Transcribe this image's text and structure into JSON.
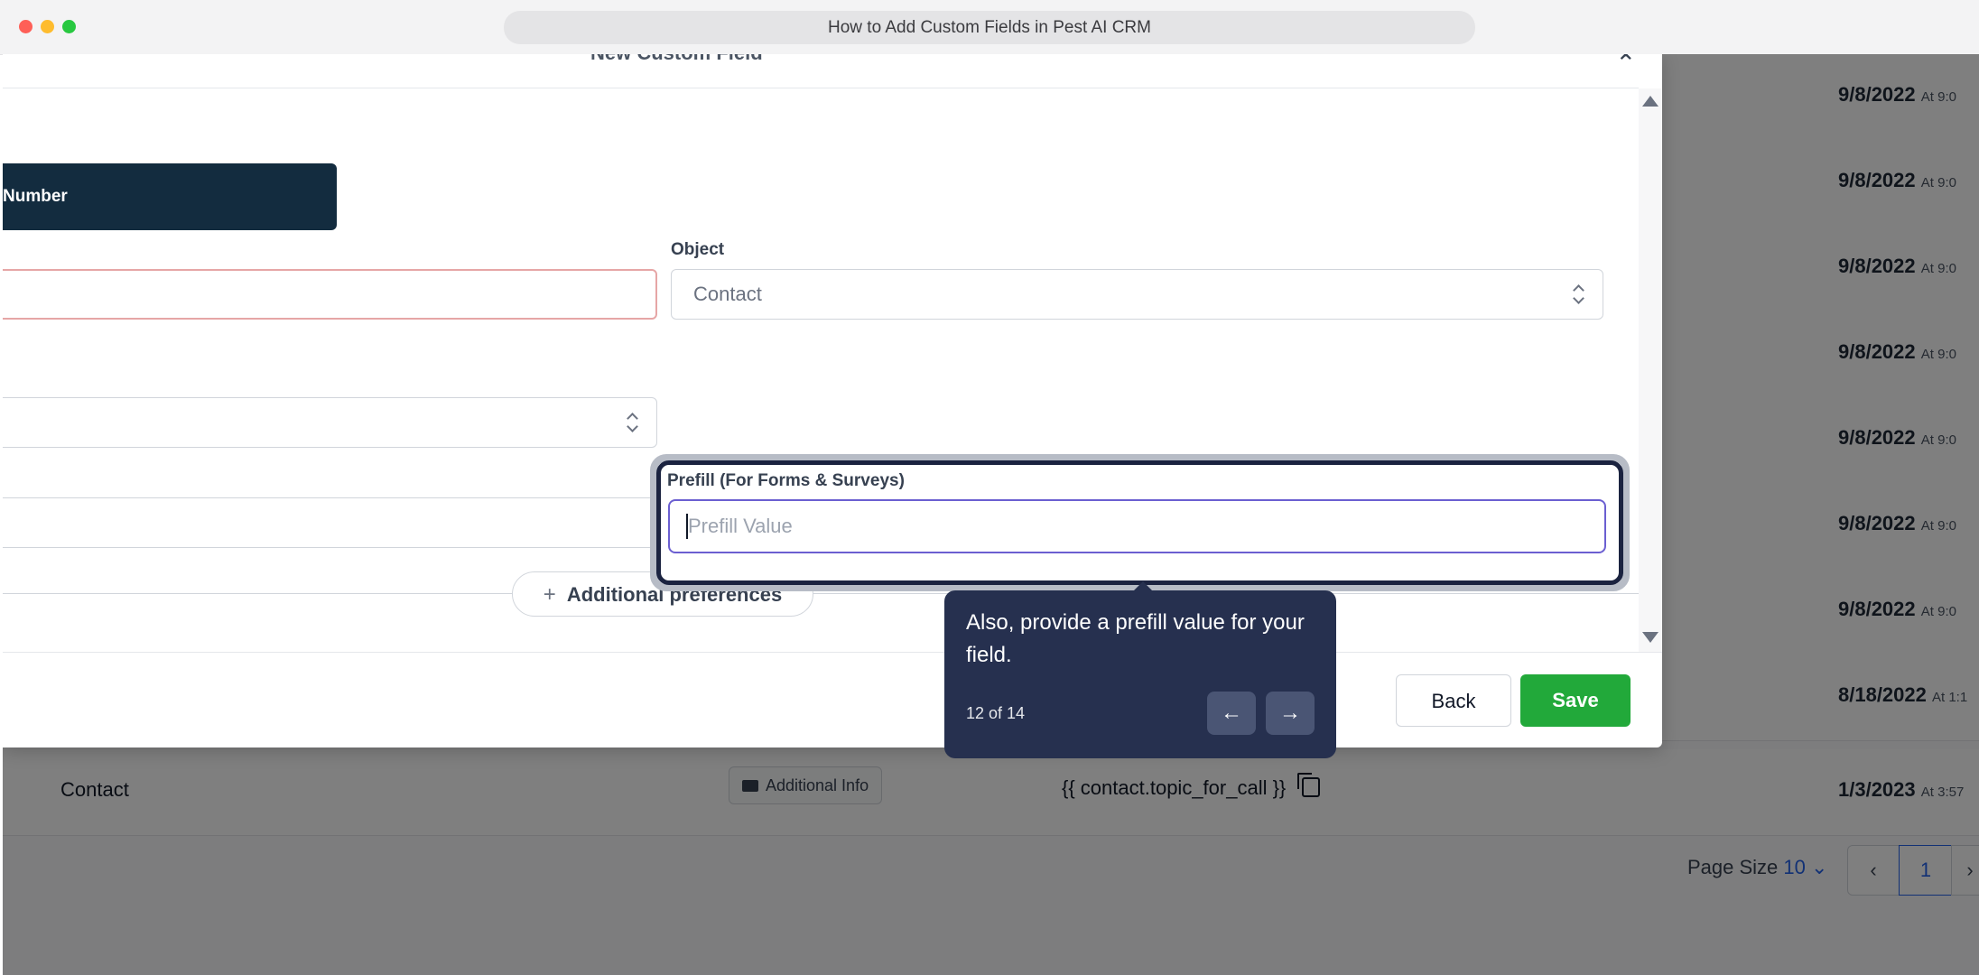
{
  "window": {
    "title": "How to Add Custom Fields in Pest AI CRM"
  },
  "background_table": {
    "rows": [
      {
        "date": "9/8/2022",
        "at": "At 9:0"
      },
      {
        "date": "9/8/2022",
        "at": "At 9:0"
      },
      {
        "date": "9/8/2022",
        "at": "At 9:0"
      },
      {
        "date": "9/8/2022",
        "at": "At 9:0"
      },
      {
        "date": "9/8/2022",
        "at": "At 9:0"
      },
      {
        "date": "9/8/2022",
        "at": "At 9:0"
      },
      {
        "date": "9/8/2022",
        "at": "At 9:0"
      },
      {
        "date": "8/18/2022",
        "at": "At 1:1"
      }
    ],
    "last_row": {
      "name": "Contact",
      "folder": "Additional Info",
      "key": "{{ contact.topic_for_call }}",
      "date": "1/3/2023",
      "at": "At 3:57"
    },
    "pagination": {
      "label": "Page Size",
      "size": "10",
      "current_page": "1"
    }
  },
  "modal": {
    "title": "New Custom Field",
    "field_type": "Number",
    "object_label": "Object",
    "object_value": "Contact",
    "prefill_label": "Prefill (For Forms & Surveys)",
    "prefill_placeholder": "Prefill Value",
    "additional_preferences": "Additional preferences",
    "back_label": "Back",
    "save_label": "Save"
  },
  "tooltip": {
    "text": "Also, provide a prefill value for your field.",
    "step": "12 of 14"
  },
  "colors": {
    "save": "#22a93a",
    "tooltip_bg": "#26304f",
    "type_card": "#132c3f",
    "accent": "#2563eb"
  }
}
